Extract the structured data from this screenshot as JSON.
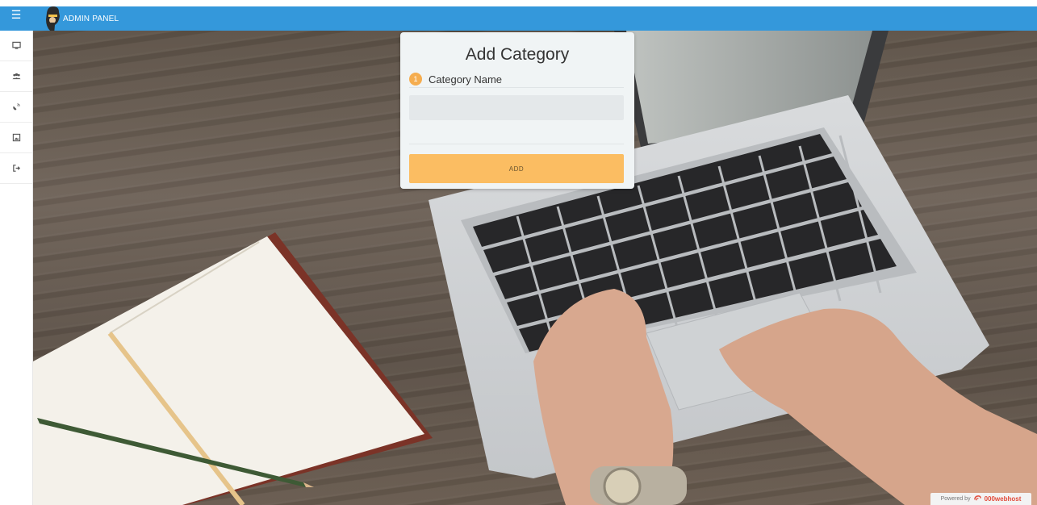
{
  "header": {
    "brand": "ADMIN PANEL",
    "menu_icon": "hamburger-icon",
    "color": "#3498db"
  },
  "sidebar": {
    "items": [
      {
        "icon": "monitor-icon"
      },
      {
        "icon": "users-icon"
      },
      {
        "icon": "satellite-icon"
      },
      {
        "icon": "image-icon"
      },
      {
        "icon": "sign-out-icon"
      }
    ]
  },
  "form": {
    "title": "Add Category",
    "step_number": "1",
    "field_label": "Category Name",
    "input_value": "",
    "button_label": "ADD",
    "accent": "#fbbd62"
  },
  "footer": {
    "powered_by": "Powered by",
    "host_name": "000webhost"
  }
}
